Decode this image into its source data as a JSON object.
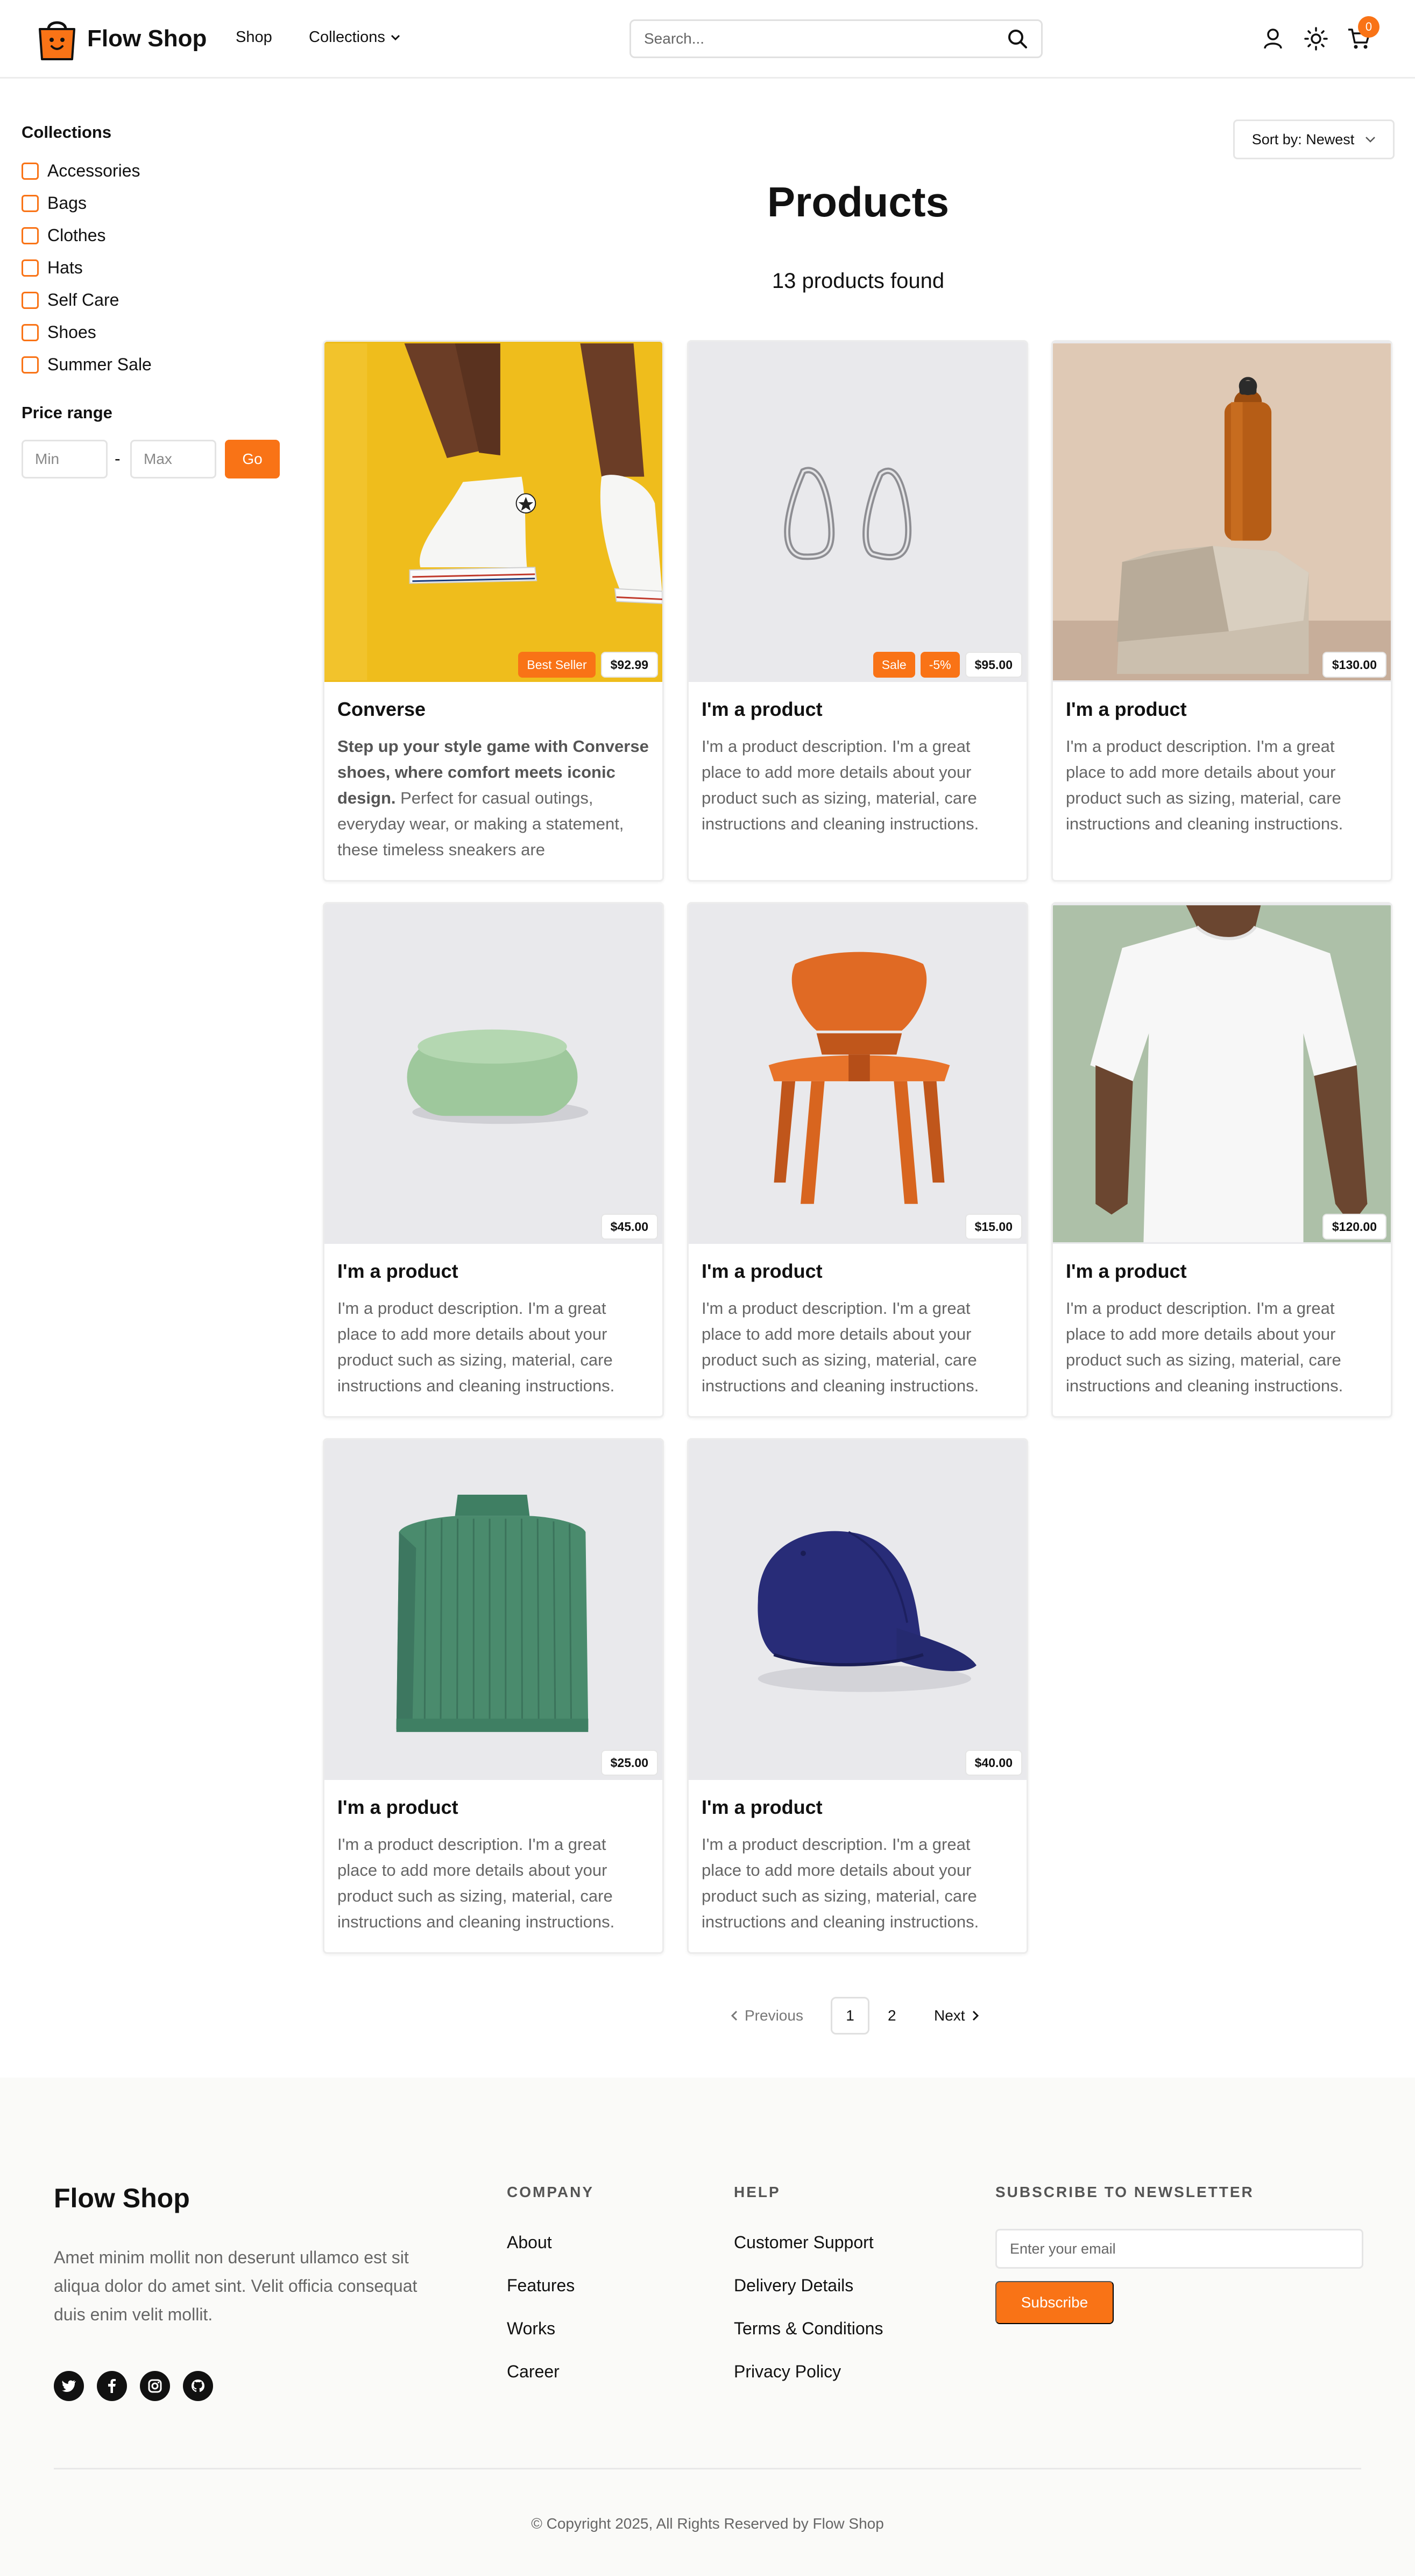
{
  "brand": {
    "name": "Flow Shop",
    "accent": "#f97316"
  },
  "header": {
    "nav": {
      "shop": "Shop",
      "collections": "Collections"
    },
    "search_placeholder": "Search...",
    "cart_count": "0",
    "icons": [
      "user-icon",
      "sun-icon",
      "cart-icon"
    ]
  },
  "sidebar": {
    "collections_title": "Collections",
    "collections": [
      "Accessories",
      "Bags",
      "Clothes",
      "Hats",
      "Self Care",
      "Shoes",
      "Summer Sale"
    ],
    "price_title": "Price range",
    "min_placeholder": "Min",
    "max_placeholder": "Max",
    "dash": "-",
    "go_label": "Go"
  },
  "main": {
    "sort_label": "Sort by: Newest",
    "title": "Products",
    "found": "13 products found"
  },
  "products": [
    {
      "title": "Converse",
      "desc_bold": "Step up your style game with Converse shoes, where comfort meets iconic design.",
      "desc": " Perfect for casual outings, everyday wear, or making a statement, these timeless sneakers are",
      "badges": [
        "Best Seller"
      ],
      "price": "$92.99",
      "image": "yellow-wall-sneakers"
    },
    {
      "title": "I'm a product",
      "desc": "I'm a product description. I'm a great place to add more details about your product such as sizing, material, care instructions and cleaning instructions.",
      "badges": [
        "Sale",
        "-5%"
      ],
      "price": "$95.00",
      "image": "silver-earrings"
    },
    {
      "title": "I'm a product",
      "desc": "I'm a product description. I'm a great place to add more details about your product such as sizing, material, care instructions and cleaning instructions.",
      "badges": [],
      "price": "$130.00",
      "image": "copper-bottle-on-stone"
    },
    {
      "title": "I'm a product",
      "desc": "I'm a product description. I'm a great place to add more details about your product such as sizing, material, care instructions and cleaning instructions.",
      "badges": [],
      "price": "$45.00",
      "image": "green-soap"
    },
    {
      "title": "I'm a product",
      "desc": "I'm a product description. I'm a great place to add more details about your product such as sizing, material, care instructions and cleaning instructions.",
      "badges": [],
      "price": "$15.00",
      "image": "wooden-chair"
    },
    {
      "title": "I'm a product",
      "desc": "I'm a product description. I'm a great place to add more details about your product such as sizing, material, care instructions and cleaning instructions.",
      "badges": [],
      "price": "$120.00",
      "image": "white-tshirt"
    },
    {
      "title": "I'm a product",
      "desc": "I'm a product description. I'm a great place to add more details about your product such as sizing, material, care instructions and cleaning instructions.",
      "badges": [],
      "price": "$25.00",
      "image": "green-sweater"
    },
    {
      "title": "I'm a product",
      "desc": "I'm a product description. I'm a great place to add more details about your product such as sizing, material, care instructions and cleaning instructions.",
      "badges": [],
      "price": "$40.00",
      "image": "navy-cap"
    }
  ],
  "pagination": {
    "previous": "Previous",
    "pages": [
      "1",
      "2"
    ],
    "current": "1",
    "next": "Next"
  },
  "footer": {
    "brand": "Flow Shop",
    "text": "Amet minim mollit non deserunt ullamco est sit aliqua dolor do amet sint. Velit officia consequat duis enim velit mollit.",
    "social": [
      "twitter-icon",
      "facebook-icon",
      "instagram-icon",
      "github-icon"
    ],
    "company": {
      "title": "COMPANY",
      "links": [
        "About",
        "Features",
        "Works",
        "Career"
      ]
    },
    "help": {
      "title": "HELP",
      "links": [
        "Customer Support",
        "Delivery Details",
        "Terms & Conditions",
        "Privacy Policy"
      ]
    },
    "newsletter": {
      "title": "SUBSCRIBE TO NEWSLETTER",
      "placeholder": "Enter your email",
      "button": "Subscribe"
    },
    "copyright": "© Copyright 2025, All Rights Reserved by Flow Shop"
  }
}
